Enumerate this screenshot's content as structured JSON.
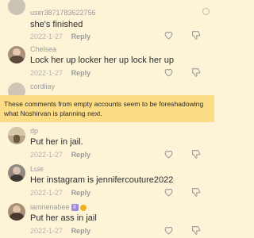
{
  "comments": [
    {
      "username": "user3871783622756",
      "text": "she's finished",
      "date": "2022-1-27",
      "reply": "Reply"
    },
    {
      "username": "Chelsea",
      "text": "Lock her up locker her up lock her up",
      "date": "2022-1-27",
      "reply": "Reply"
    },
    {
      "username": "cordliay"
    },
    {
      "username": "dp",
      "text": "Put her in jail.",
      "date": "2022-1-27",
      "reply": "Reply"
    },
    {
      "username": "Luie",
      "text": "Her instagram is jennifercouture2022",
      "date": "2022-1-27",
      "reply": "Reply"
    },
    {
      "username": "iamnenabee",
      "text": "Put her ass in jail",
      "date": "2022-1-27",
      "reply": "Reply"
    }
  ],
  "banner": {
    "text": "These comments from empty accounts seem to be foreshadowing what Noshirvan is planning next."
  },
  "badge_text": "II",
  "icons": {
    "like": "heart-icon",
    "dislike": "thumbs-down-icon",
    "scroll": "scroll-indicator-icon"
  },
  "colors": {
    "background": "#fdf4d8",
    "banner": "#fddc86",
    "text": "#2b2b2b",
    "muted": "#9b9b9b"
  }
}
